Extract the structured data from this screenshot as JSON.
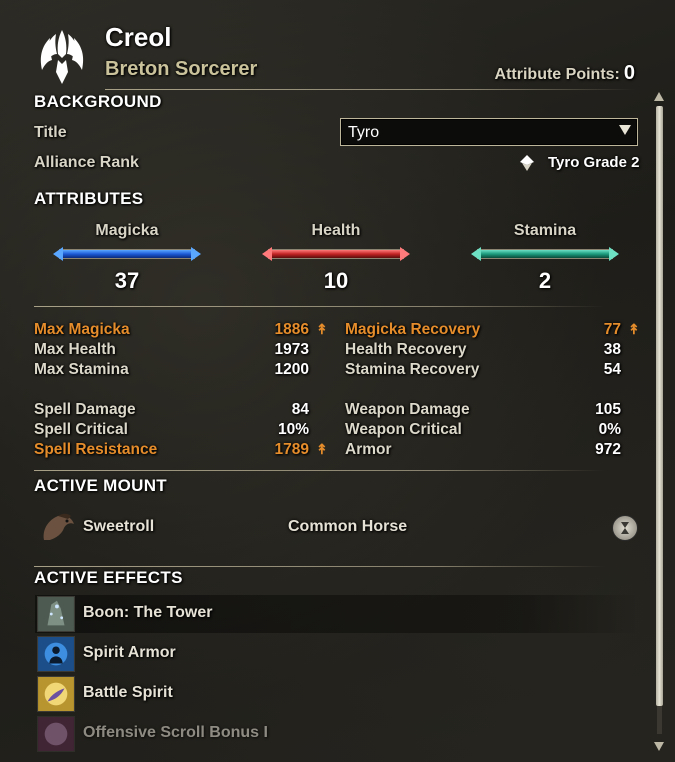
{
  "header": {
    "name": "Creol",
    "class": "Breton Sorcerer",
    "attribute_points_label": "Attribute Points:",
    "attribute_points_value": "0",
    "emblem_icon": "winged-emblem-icon"
  },
  "background": {
    "section_title": "BACKGROUND",
    "title_label": "Title",
    "title_value": "Tyro",
    "alliance_rank_label": "Alliance Rank",
    "alliance_rank_value": "Tyro Grade 2"
  },
  "attributes": {
    "section_title": "ATTRIBUTES",
    "items": [
      {
        "label": "Magicka",
        "value": "37",
        "color": "#1d5ad6"
      },
      {
        "label": "Health",
        "value": "10",
        "color": "#c22424"
      },
      {
        "label": "Stamina",
        "value": "2",
        "color": "#1c9a7c"
      }
    ]
  },
  "stats": {
    "left": [
      {
        "label": "Max Magicka",
        "value": "1886",
        "buffed": true
      },
      {
        "label": "Max Health",
        "value": "1973",
        "buffed": false
      },
      {
        "label": "Max Stamina",
        "value": "1200",
        "buffed": false
      },
      {
        "label": "Spell Damage",
        "value": "84",
        "buffed": false
      },
      {
        "label": "Spell Critical",
        "value": "10%",
        "buffed": false
      },
      {
        "label": "Spell Resistance",
        "value": "1789",
        "buffed": true
      }
    ],
    "right": [
      {
        "label": "Magicka Recovery",
        "value": "77",
        "buffed": true
      },
      {
        "label": "Health Recovery",
        "value": "38",
        "buffed": false
      },
      {
        "label": "Stamina Recovery",
        "value": "54",
        "buffed": false
      },
      {
        "label": "Weapon Damage",
        "value": "105",
        "buffed": false
      },
      {
        "label": "Weapon Critical",
        "value": "0%",
        "buffed": false
      },
      {
        "label": "Armor",
        "value": "972",
        "buffed": false
      }
    ],
    "buff_color": "#e58c2b"
  },
  "mount": {
    "section_title": "ACTIVE MOUNT",
    "name": "Sweetroll",
    "type": "Common Horse"
  },
  "effects": {
    "section_title": "ACTIVE EFFECTS",
    "items": [
      {
        "name": "Boon: The Tower"
      },
      {
        "name": "Spirit Armor"
      },
      {
        "name": "Battle Spirit"
      },
      {
        "name": "Offensive Scroll Bonus I"
      }
    ]
  }
}
